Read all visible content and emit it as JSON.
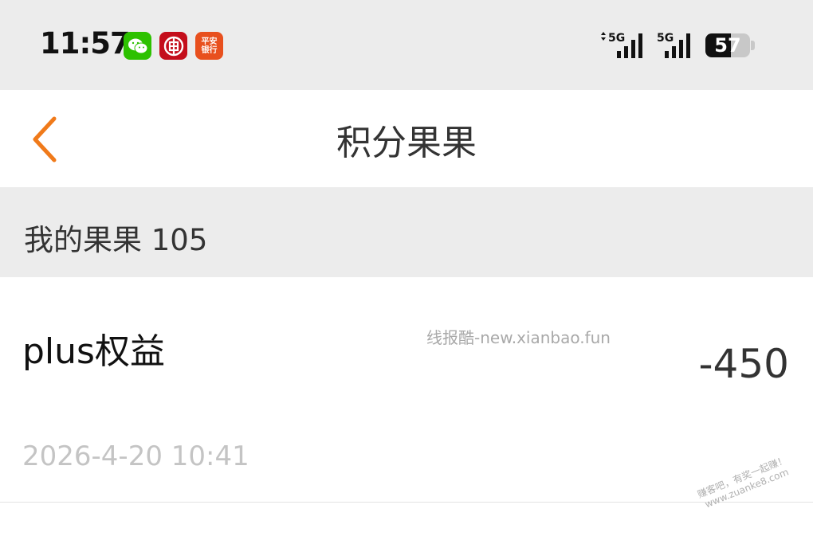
{
  "status_bar": {
    "time": "11:57",
    "network_1": "5G",
    "network_2": "5G",
    "battery_level": "57",
    "battery_fraction": 0.57,
    "notification_icons": [
      "wechat-icon",
      "icbc-bank-icon",
      "pingan-bank-icon"
    ],
    "pingan_label_line1": "平安",
    "pingan_label_line2": "银行"
  },
  "nav": {
    "back_icon": "chevron-left-icon",
    "title": "积分果果",
    "accent_color": "#f07a1a"
  },
  "summary": {
    "text": "我的果果 105"
  },
  "records": [
    {
      "title": "plus权益",
      "amount": "-450",
      "time": "2026-4-20 10:41"
    }
  ],
  "watermarks": {
    "center": "线报酷-new.xianbao.fun",
    "corner_line1": "赚客吧，有奖一起赚！",
    "corner_line2": "www.zuanke8.com"
  }
}
